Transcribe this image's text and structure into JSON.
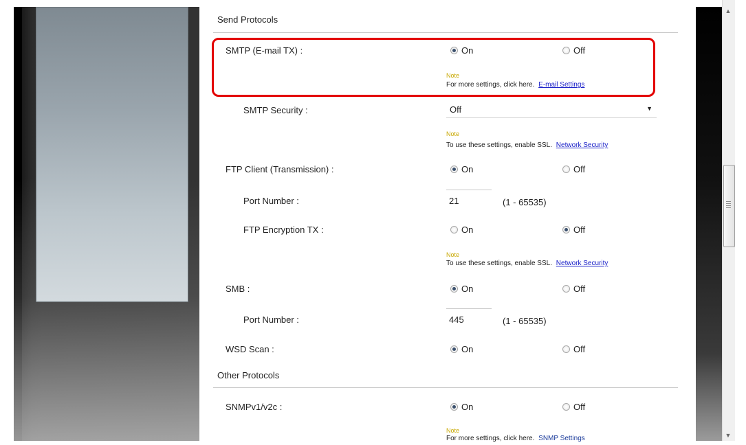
{
  "send_protocols": {
    "title": "Send Protocols",
    "smtp": {
      "label": "SMTP (E-mail TX) :",
      "on": "On",
      "off": "Off",
      "note_label": "Note",
      "note_text": "For more settings, click here.",
      "note_link": "E-mail Settings"
    },
    "smtp_security": {
      "label": "SMTP Security :",
      "value": "Off",
      "note_label": "Note",
      "note_text": "To use these settings, enable SSL.",
      "note_link": "Network Security"
    },
    "ftp_client": {
      "label": "FTP Client (Transmission) :",
      "on": "On",
      "off": "Off"
    },
    "ftp_port": {
      "label": "Port Number :",
      "value": "21",
      "range": "(1 - 65535)"
    },
    "ftp_encryption": {
      "label": "FTP Encryption TX :",
      "on": "On",
      "off": "Off",
      "note_label": "Note",
      "note_text": "To use these settings, enable SSL.",
      "note_link": "Network Security"
    },
    "smb": {
      "label": "SMB :",
      "on": "On",
      "off": "Off"
    },
    "smb_port": {
      "label": "Port Number :",
      "value": "445",
      "range": "(1 - 65535)"
    },
    "wsd_scan": {
      "label": "WSD Scan :",
      "on": "On",
      "off": "Off"
    }
  },
  "other_protocols": {
    "title": "Other Protocols",
    "snmp": {
      "label": "SNMPv1/v2c :",
      "on": "On",
      "off": "Off",
      "note_label": "Note",
      "note_text": "For more settings, click here.",
      "note_link": "SNMP Settings"
    }
  },
  "scrollbar": {
    "up_icon": "▲",
    "down_icon": "▼"
  },
  "colors": {
    "highlight": "#e30000",
    "link": "#1a20c8",
    "note": "#c8a800"
  }
}
